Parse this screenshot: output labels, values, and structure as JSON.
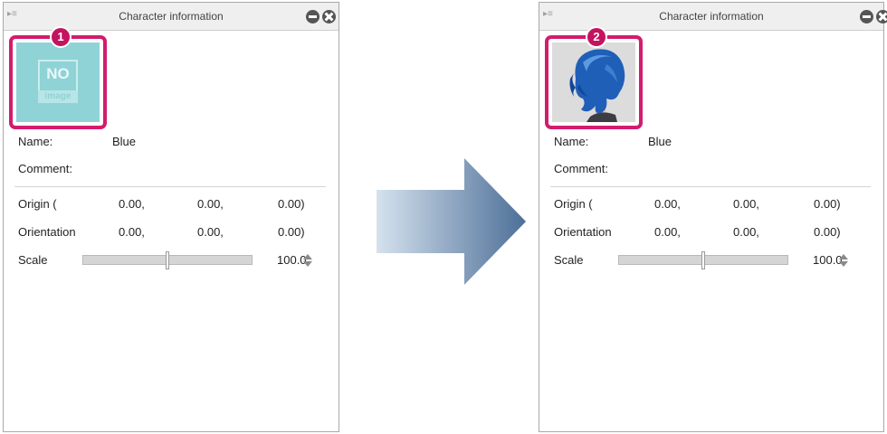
{
  "panels": [
    {
      "title": "Character information",
      "badge": "1",
      "thumbnail": {
        "type": "no-image",
        "main_text": "NO",
        "sub_text": "image",
        "color": "#8fd3d6"
      },
      "name_label": "Name:",
      "name_value": "Blue",
      "comment_label": "Comment:",
      "origin_label": "Origin (",
      "origin_values": [
        "0.00,",
        "0.00,",
        "0.00)"
      ],
      "orientation_label": "Orientation",
      "orientation_values": [
        "0.00,",
        "0.00,",
        "0.00)"
      ],
      "scale_label": "Scale",
      "scale_value": "100.0",
      "scale_slider_level": 0.5
    },
    {
      "title": "Character information",
      "badge": "2",
      "thumbnail": {
        "type": "character-avatar",
        "hair_color": "#1f5fb8"
      },
      "name_label": "Name:",
      "name_value": "Blue",
      "comment_label": "Comment:",
      "origin_label": "Origin (",
      "origin_values": [
        "0.00,",
        "0.00,",
        "0.00)"
      ],
      "orientation_label": "Orientation",
      "orientation_values": [
        "0.00,",
        "0.00,",
        "0.00)"
      ],
      "scale_label": "Scale",
      "scale_value": "100.0",
      "scale_slider_level": 0.5
    }
  ],
  "colors": {
    "highlight_frame": "#d21c6e",
    "badge": "#c4135f",
    "arrow_start": "#d5e2ee",
    "arrow_end": "#4d6f98"
  },
  "icons": [
    "panel-menu-icon",
    "minimize-icon",
    "close-icon",
    "spinner-icon",
    "right-arrow-icon"
  ]
}
